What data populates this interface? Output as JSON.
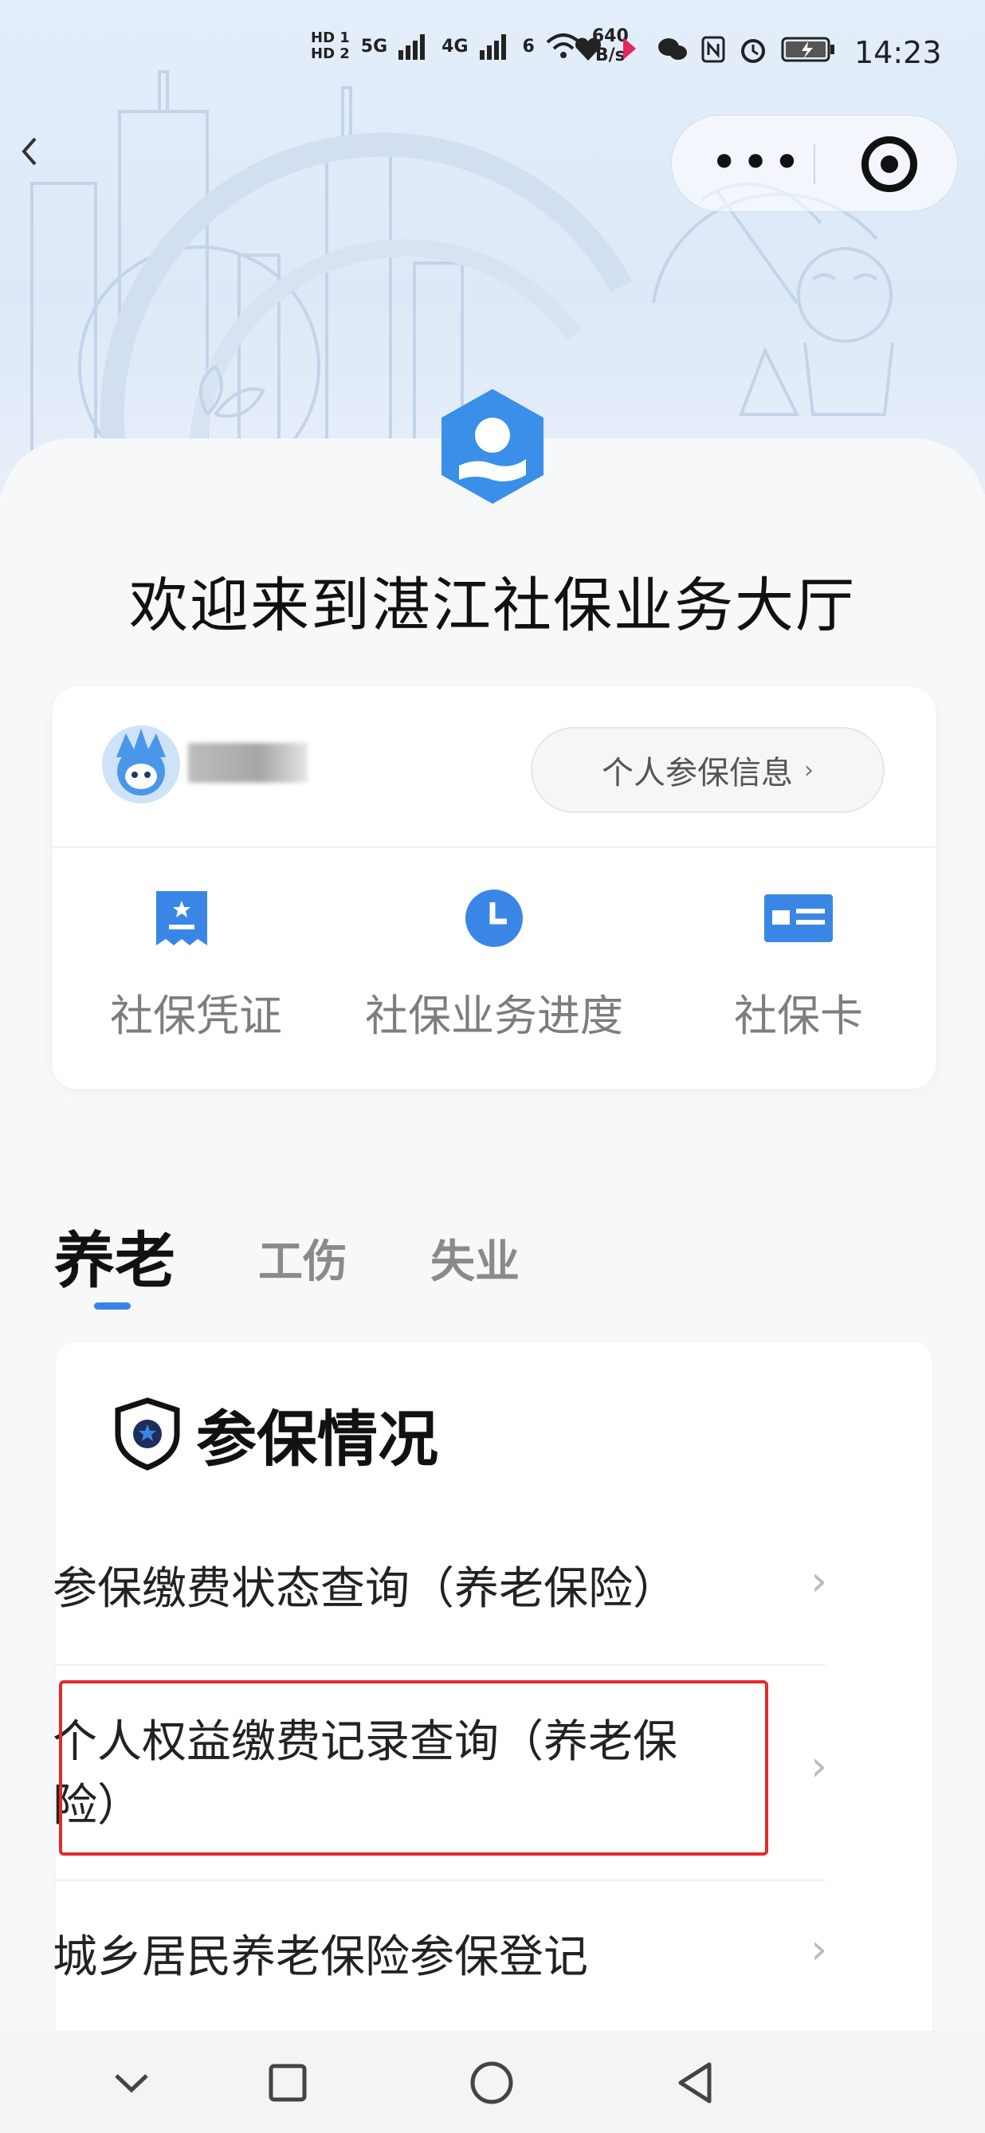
{
  "status_bar": {
    "hd1": "HD 1",
    "hd2": "HD 2",
    "net1": "5G",
    "net2": "4G",
    "wifi_num": "6",
    "speed_value": "640",
    "speed_unit": "B/s",
    "time": "14:23"
  },
  "welcome_title": "欢迎来到湛江社保业务大厅",
  "user_card": {
    "info_button": "个人参保信息",
    "info_chevron": "›",
    "quick_actions": [
      {
        "label": "社保凭证",
        "icon": "ribbon-certificate-icon"
      },
      {
        "label": "社保业务进度",
        "icon": "clock-icon"
      },
      {
        "label": "社保卡",
        "icon": "id-card-icon"
      }
    ]
  },
  "tabs": [
    {
      "label": "养老",
      "active": true
    },
    {
      "label": "工伤",
      "active": false
    },
    {
      "label": "失业",
      "active": false
    }
  ],
  "section": {
    "title": "参保情况",
    "items": [
      {
        "label": "参保缴费状态查询（养老保险）"
      },
      {
        "label_line1": "个人权益缴费记录查询（养老保",
        "label_line2": "险）"
      },
      {
        "label": "城乡居民养老保险参保登记"
      }
    ],
    "chevron": "›"
  },
  "colors": {
    "accent": "#3b82e6",
    "highlight": "#e12b2b"
  }
}
